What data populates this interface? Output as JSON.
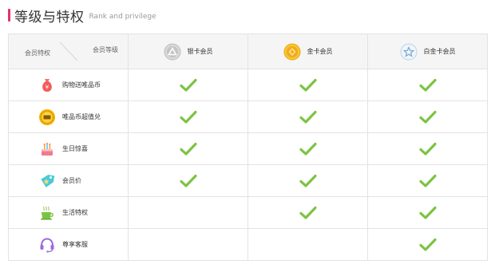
{
  "header": {
    "title": "等级与特权",
    "subtitle": "Rank and privilege"
  },
  "table": {
    "corner_left": "会员特权",
    "corner_right": "会员等级",
    "tiers": [
      {
        "label": "银卡会员",
        "icon": "silver-card-icon"
      },
      {
        "label": "金卡会员",
        "icon": "gold-card-icon"
      },
      {
        "label": "白金卡会员",
        "icon": "platinum-card-icon"
      }
    ],
    "rows": [
      {
        "label": "购物送唯品币",
        "icon": "money-bag-icon",
        "checks": [
          true,
          true,
          true
        ]
      },
      {
        "label": "唯品币超值兑",
        "icon": "vip-coin-icon",
        "checks": [
          true,
          true,
          true
        ]
      },
      {
        "label": "生日惊喜",
        "icon": "birthday-cake-icon",
        "checks": [
          true,
          true,
          true
        ]
      },
      {
        "label": "会员价",
        "icon": "price-tag-icon",
        "checks": [
          true,
          true,
          true
        ]
      },
      {
        "label": "生活特权",
        "icon": "coffee-cup-icon",
        "checks": [
          false,
          true,
          true
        ]
      },
      {
        "label": "尊享客服",
        "icon": "headset-icon",
        "checks": [
          false,
          false,
          true
        ]
      }
    ]
  },
  "colors": {
    "accent": "#e4306f",
    "check": "#7cc342",
    "header_bg": "#f5f5f5",
    "border": "#e3e3e3"
  }
}
